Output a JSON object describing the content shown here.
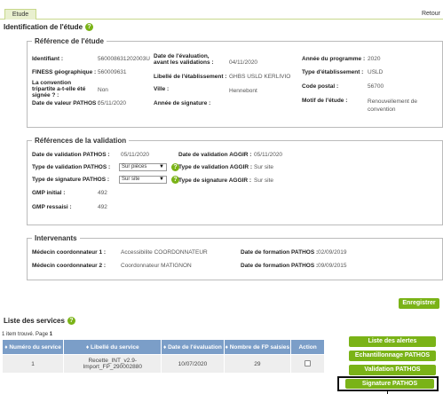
{
  "tabs": {
    "active": "Etude",
    "back": "Retour"
  },
  "page_title": "Identification de l'étude",
  "help_glyph": "?",
  "ref_etude": {
    "legend": "Référence de l'étude",
    "identifiant_label": "Identifiant :",
    "identifiant_value": "560008631202003U",
    "finess_label": "FINESS géographique :",
    "finess_value": "560009631",
    "convention_label": "La convention tripartite a-t-elle été signée ? :",
    "convention_value": "Non",
    "date_valeur_label": "Date de valeur PATHOS :",
    "date_valeur_value": "05/11/2020",
    "date_eval_label": "Date de l'évaluation, avant les validations :",
    "date_eval_value": "04/11/2020",
    "libelle_label": "Libellé de l'établissement :",
    "libelle_value": "GHBS USLD KERLIVIO",
    "ville_label": "Ville :",
    "ville_value": "Hennebont",
    "annee_sig_label": "Année de signature :",
    "annee_sig_value": "",
    "annee_prog_label": "Année du programme :",
    "annee_prog_value": "2020",
    "type_etab_label": "Type d'établissement :",
    "type_etab_value": "USLD",
    "code_postal_label": "Code postal :",
    "code_postal_value": "56700",
    "motif_label": "Motif de l'étude :",
    "motif_value": "Renouvellement de convention"
  },
  "ref_validation": {
    "legend": "Références de la validation",
    "date_pathos_label": "Date de validation PATHOS :",
    "date_pathos_value": "05/11/2020",
    "date_aggir_label": "Date de validation AGGIR :",
    "date_aggir_value": "05/11/2020",
    "type_val_pathos_label": "Type de validation PATHOS :",
    "type_val_pathos_value": "Sur pièces",
    "type_val_aggir_label": "Type de validation AGGIR :",
    "type_val_aggir_value": "Sur site",
    "type_sig_pathos_label": "Type de signature PATHOS :",
    "type_sig_pathos_value": "Sur site",
    "type_sig_aggir_label": "Type de signature AGGIR :",
    "type_sig_aggir_value": "Sur site",
    "gmp_initial_label": "GMP initial :",
    "gmp_initial_value": "492",
    "gmp_reessai_label": "GMP ressaisi :",
    "gmp_reessai_value": "492"
  },
  "intervenants": {
    "legend": "Intervenants",
    "coord1_label": "Médecin coordonnateur 1 :",
    "coord1_value": "Accessibilite COORDONNATEUR",
    "coord2_label": "Médecin coordonnateur 2 :",
    "coord2_value": "Coordonnateur MATIGNON",
    "form1_label": "Date de formation PATHOS :",
    "form1_value": "02/09/2019",
    "form2_label": "Date de formation PATHOS :",
    "form2_value": "09/09/2015"
  },
  "buttons": {
    "enregistrer": "Enregistrer",
    "liste_alertes": "Liste des alertes",
    "echantillonnage": "Echantillonnage PATHOS",
    "validation": "Validation PATHOS",
    "signature": "Signature PATHOS"
  },
  "services": {
    "title": "Liste des services",
    "found_text": "1 item trouvé. Page",
    "page": "1",
    "headers": [
      "♦ Numéro du service",
      "♦ Libellé du service",
      "♦ Date de l'évaluation",
      "♦ Nombre de FP saisies",
      "Action"
    ],
    "rows": [
      {
        "numero": "1",
        "libelle": "Recette_INT_v2.9-Import_FP_290002880",
        "date": "10/07/2020",
        "nombre": "29"
      }
    ]
  },
  "colors": {
    "accent_green": "#7ab317",
    "table_header": "#7b9ec8",
    "tab_bg": "#e9f0cf"
  }
}
